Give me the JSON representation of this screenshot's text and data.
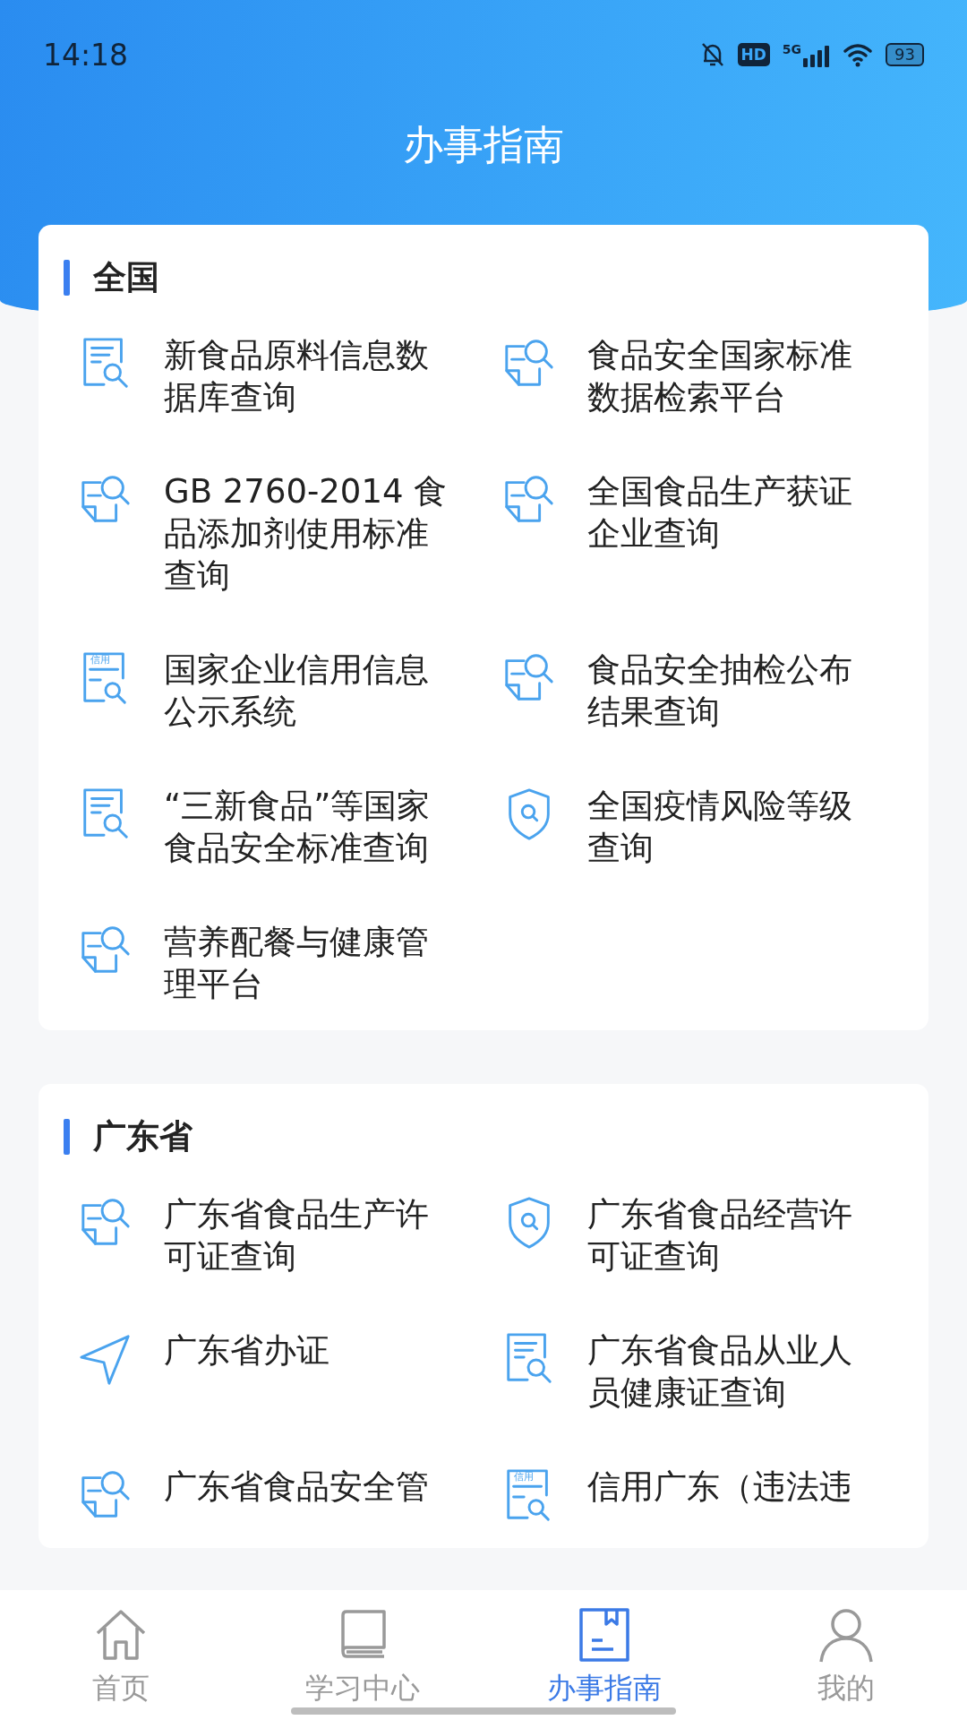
{
  "status_bar": {
    "time": "14:18",
    "hd": "HD",
    "network": "5G",
    "battery": "93"
  },
  "header": {
    "title": "办事指南"
  },
  "sections": [
    {
      "title": "全国",
      "items": [
        {
          "kind": "doc-search",
          "title": "新食品原料信息数据库查询"
        },
        {
          "kind": "folded-search",
          "title": "食品安全国家标准数据检索平台"
        },
        {
          "kind": "folded-search",
          "title": "GB 2760-2014 食品添加剂使用标准查询"
        },
        {
          "kind": "folded-search",
          "title": "全国食品生产获证企业查询"
        },
        {
          "kind": "credit-search",
          "icon_label": "信用",
          "title": "国家企业信用信息公示系统"
        },
        {
          "kind": "folded-search",
          "title": "食品安全抽检公布结果查询"
        },
        {
          "kind": "doc-search",
          "title": "“三新食品”等国家食品安全标准查询"
        },
        {
          "kind": "shield-search",
          "title": "全国疫情风险等级查询"
        },
        {
          "kind": "folded-search",
          "title": "营养配餐与健康管理平台"
        }
      ]
    },
    {
      "title": "广东省",
      "items": [
        {
          "kind": "folded-search",
          "title": "广东省食品生产许可证查询"
        },
        {
          "kind": "shield-search",
          "title": "广东省食品经营许可证查询"
        },
        {
          "kind": "send",
          "title": "广东省办证"
        },
        {
          "kind": "doc-search",
          "title": "广东省食品从业人员健康证查询"
        },
        {
          "kind": "folded-search",
          "title": "广东省食品安全管"
        },
        {
          "kind": "credit-search",
          "icon_label": "信用",
          "title": "信用广东（违法违"
        }
      ]
    }
  ],
  "tabs": [
    {
      "kind": "home",
      "label": "首页",
      "selected": false
    },
    {
      "kind": "book",
      "label": "学习中心",
      "selected": false
    },
    {
      "kind": "guide",
      "label": "办事指南",
      "selected": true
    },
    {
      "kind": "profile",
      "label": "我的",
      "selected": false
    }
  ]
}
